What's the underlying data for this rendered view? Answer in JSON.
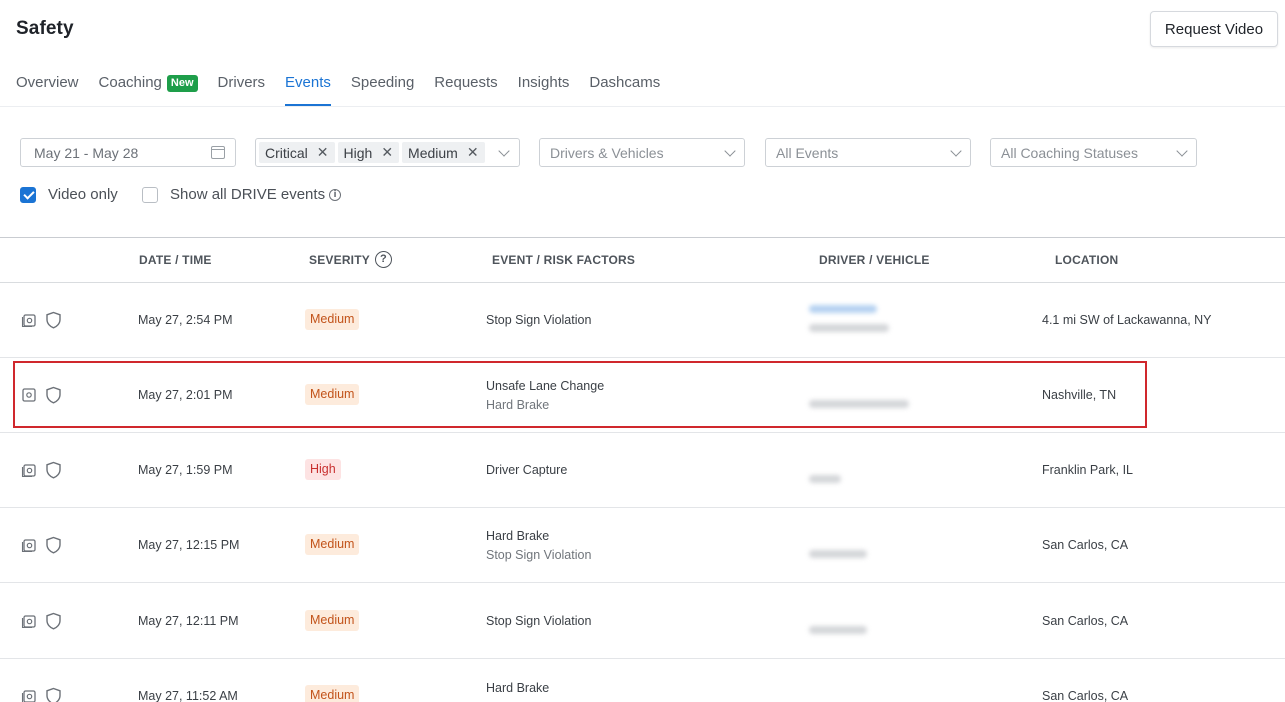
{
  "header": {
    "title": "Safety",
    "request_button": "Request Video"
  },
  "tabs": [
    {
      "label": "Overview",
      "active": false
    },
    {
      "label": "Coaching",
      "badge": "New",
      "active": false
    },
    {
      "label": "Drivers",
      "active": false
    },
    {
      "label": "Events",
      "active": true
    },
    {
      "label": "Speeding",
      "active": false
    },
    {
      "label": "Requests",
      "active": false
    },
    {
      "label": "Insights",
      "active": false
    },
    {
      "label": "Dashcams",
      "active": false
    }
  ],
  "filters": {
    "date_range": "May 21 - May 28",
    "severity_chips": [
      "Critical",
      "High",
      "Medium"
    ],
    "drivers_vehicles_placeholder": "Drivers & Vehicles",
    "events_placeholder": "All Events",
    "coaching_status_placeholder": "All Coaching Statuses",
    "video_only": {
      "label": "Video only",
      "checked": true
    },
    "show_all_drive": {
      "label": "Show all DRIVE events",
      "checked": false
    }
  },
  "table": {
    "headers": {
      "date_time": "DATE / TIME",
      "severity": "SEVERITY",
      "event": "EVENT / RISK FACTORS",
      "driver": "DRIVER / VEHICLE",
      "location": "LOCATION"
    },
    "rows": [
      {
        "datetime": "May 27, 2:54 PM",
        "severity": "Medium",
        "event1": "Stop Sign Violation",
        "event2": "",
        "location": "4.1 mi SW of Lackawanna, NY"
      },
      {
        "datetime": "May 27, 2:01 PM",
        "severity": "Medium",
        "event1": "Unsafe Lane Change",
        "event2": "Hard Brake",
        "location": "Nashville, TN"
      },
      {
        "datetime": "May 27, 1:59 PM",
        "severity": "High",
        "event1": "Driver Capture",
        "event2": "",
        "location": "Franklin Park, IL"
      },
      {
        "datetime": "May 27, 12:15 PM",
        "severity": "Medium",
        "event1": "Hard Brake",
        "event2": "Stop Sign Violation",
        "location": "San Carlos, CA"
      },
      {
        "datetime": "May 27, 12:11 PM",
        "severity": "Medium",
        "event1": "Stop Sign Violation",
        "event2": "",
        "location": "San Carlos, CA"
      },
      {
        "datetime": "May 27, 11:52 AM",
        "severity": "Medium",
        "event1": "Hard Brake",
        "event2": "",
        "location": "San Carlos, CA"
      }
    ]
  },
  "colors": {
    "accent": "#1b74d4",
    "badge_new": "#1e9e4a",
    "highlight": "#d0282d",
    "medium_bg": "#fdebdc",
    "high_bg": "#fde3e3"
  }
}
